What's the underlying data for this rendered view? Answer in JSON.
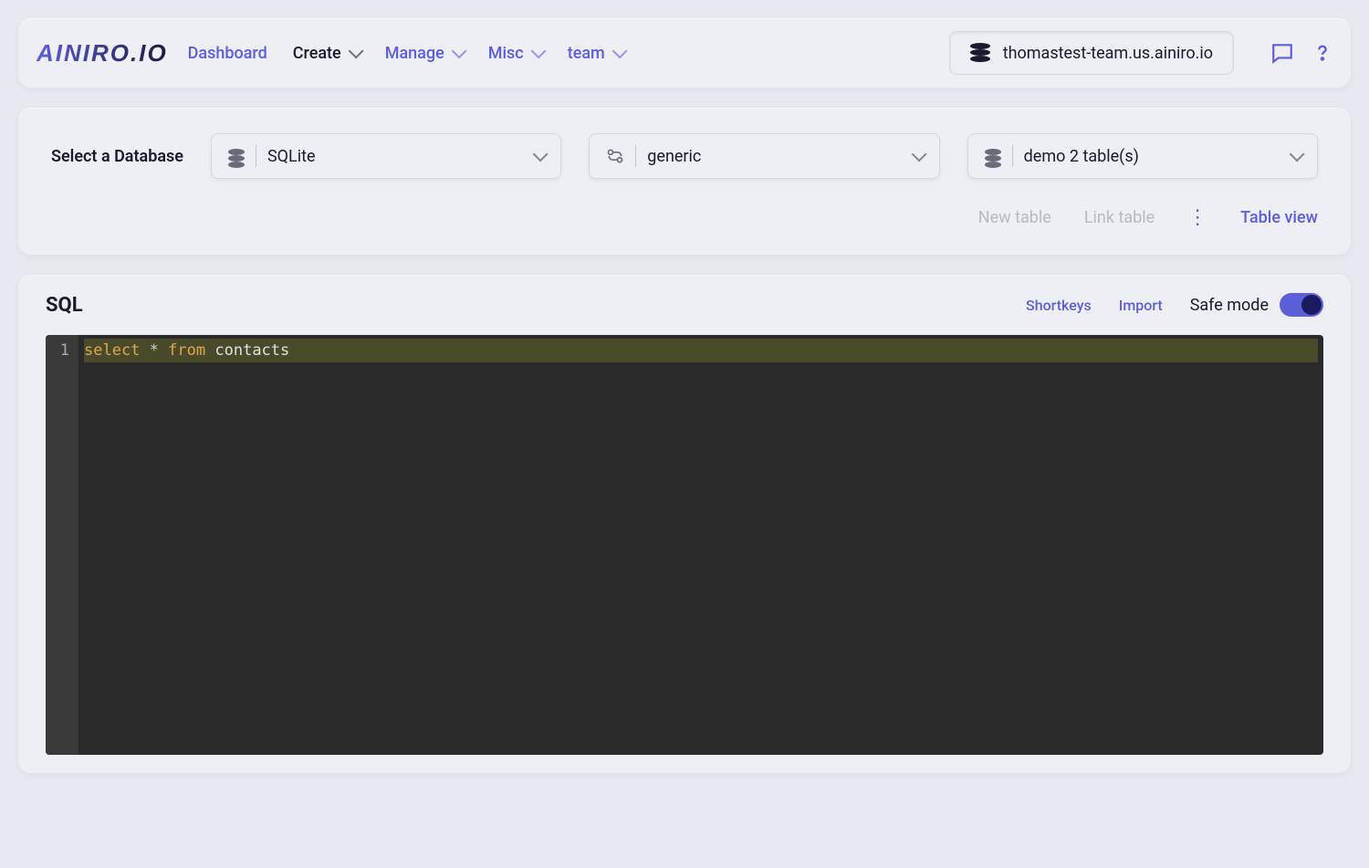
{
  "header": {
    "logo": "AINIRO.IO",
    "nav": [
      {
        "label": "Dashboard",
        "hasDropdown": false,
        "active": false
      },
      {
        "label": "Create",
        "hasDropdown": true,
        "active": true
      },
      {
        "label": "Manage",
        "hasDropdown": true,
        "active": false
      },
      {
        "label": "Misc",
        "hasDropdown": true,
        "active": false
      },
      {
        "label": "team",
        "hasDropdown": true,
        "active": false
      }
    ],
    "server": "thomastest-team.us.ainiro.io"
  },
  "dbselect": {
    "label": "Select a Database",
    "selects": [
      {
        "icon": "database",
        "value": "SQLite"
      },
      {
        "icon": "flow",
        "value": "generic"
      },
      {
        "icon": "database",
        "value": "demo 2 table(s)"
      }
    ],
    "actions": {
      "new_table": "New table",
      "link_table": "Link table",
      "table_view": "Table view"
    }
  },
  "sql": {
    "title": "SQL",
    "shortkeys": "Shortkeys",
    "import": "Import",
    "safe_mode_label": "Safe mode",
    "safe_mode_on": true,
    "code": {
      "line_number": "1",
      "kw_select": "select",
      "op_star": "*",
      "kw_from": "from",
      "ident": "contacts"
    }
  }
}
